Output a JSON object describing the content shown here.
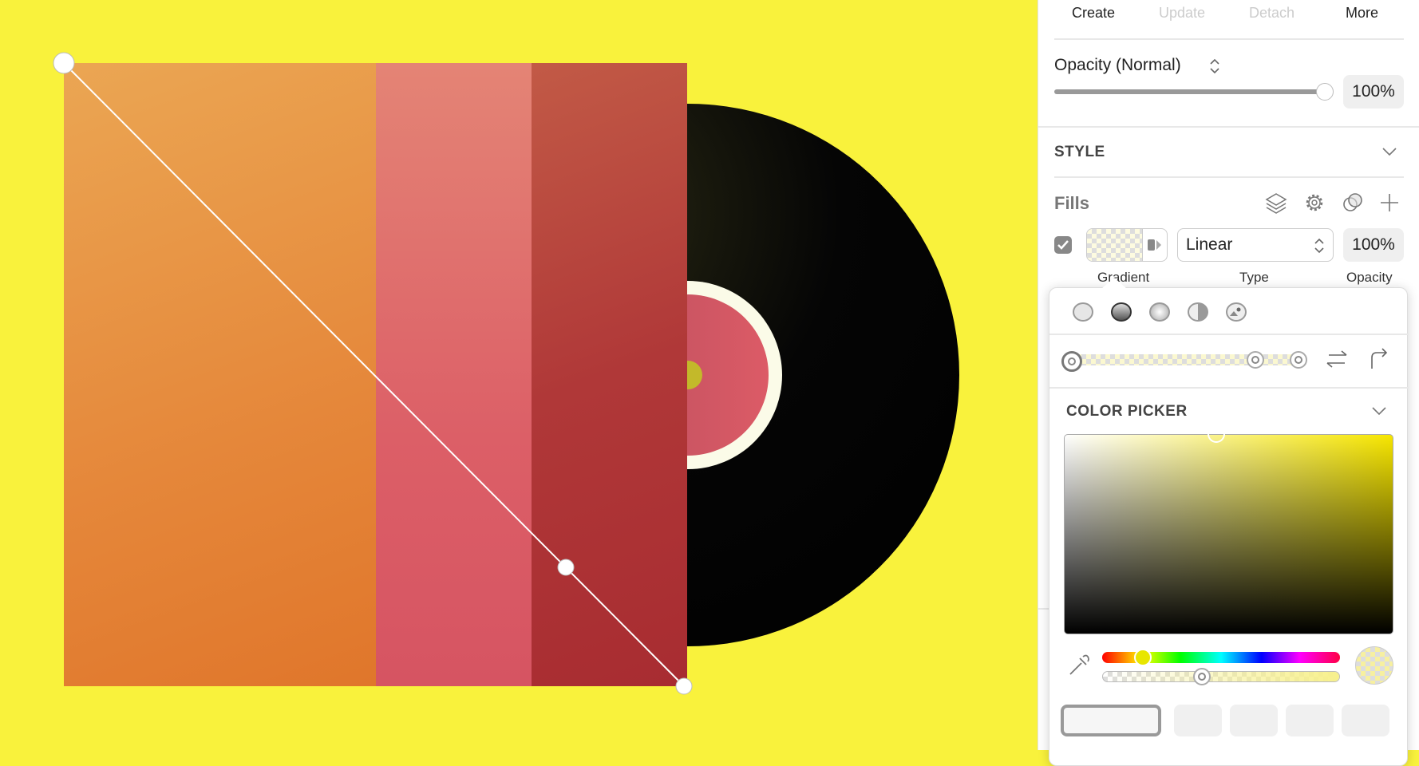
{
  "canvas": {
    "background": "#f9f23c",
    "cover_colors": [
      "#e5873a",
      "#dc5f67",
      "#b03838"
    ],
    "record_label_color": "#dc5b66"
  },
  "toolbar": {
    "tabs": [
      {
        "label": "Create",
        "enabled": true
      },
      {
        "label": "Update",
        "enabled": false
      },
      {
        "label": "Detach",
        "enabled": false
      },
      {
        "label": "More",
        "enabled": true
      }
    ]
  },
  "opacity": {
    "label": "Opacity (Normal)",
    "value": "100%",
    "slider_percent": 100
  },
  "style": {
    "title": "STYLE"
  },
  "fills": {
    "title": "Fills",
    "icons": [
      "layers-icon",
      "gear-icon",
      "blend-icon",
      "plus-icon"
    ],
    "checked": true,
    "type": "Linear",
    "opacity": "100%",
    "labels": {
      "swatch": "Gradient",
      "type": "Type",
      "opacity": "Opacity"
    }
  },
  "popover": {
    "fill_types": [
      "solid-fill-icon",
      "linear-gradient-icon",
      "radial-gradient-icon",
      "angular-gradient-icon",
      "image-fill-icon"
    ],
    "selected_fill_type": 1,
    "gradient_stops_percent": [
      0,
      76,
      96
    ],
    "color_picker_title": "COLOR PICKER",
    "hue_percent": 15,
    "alpha_percent": 40,
    "current_color": "#f7f0a0"
  }
}
